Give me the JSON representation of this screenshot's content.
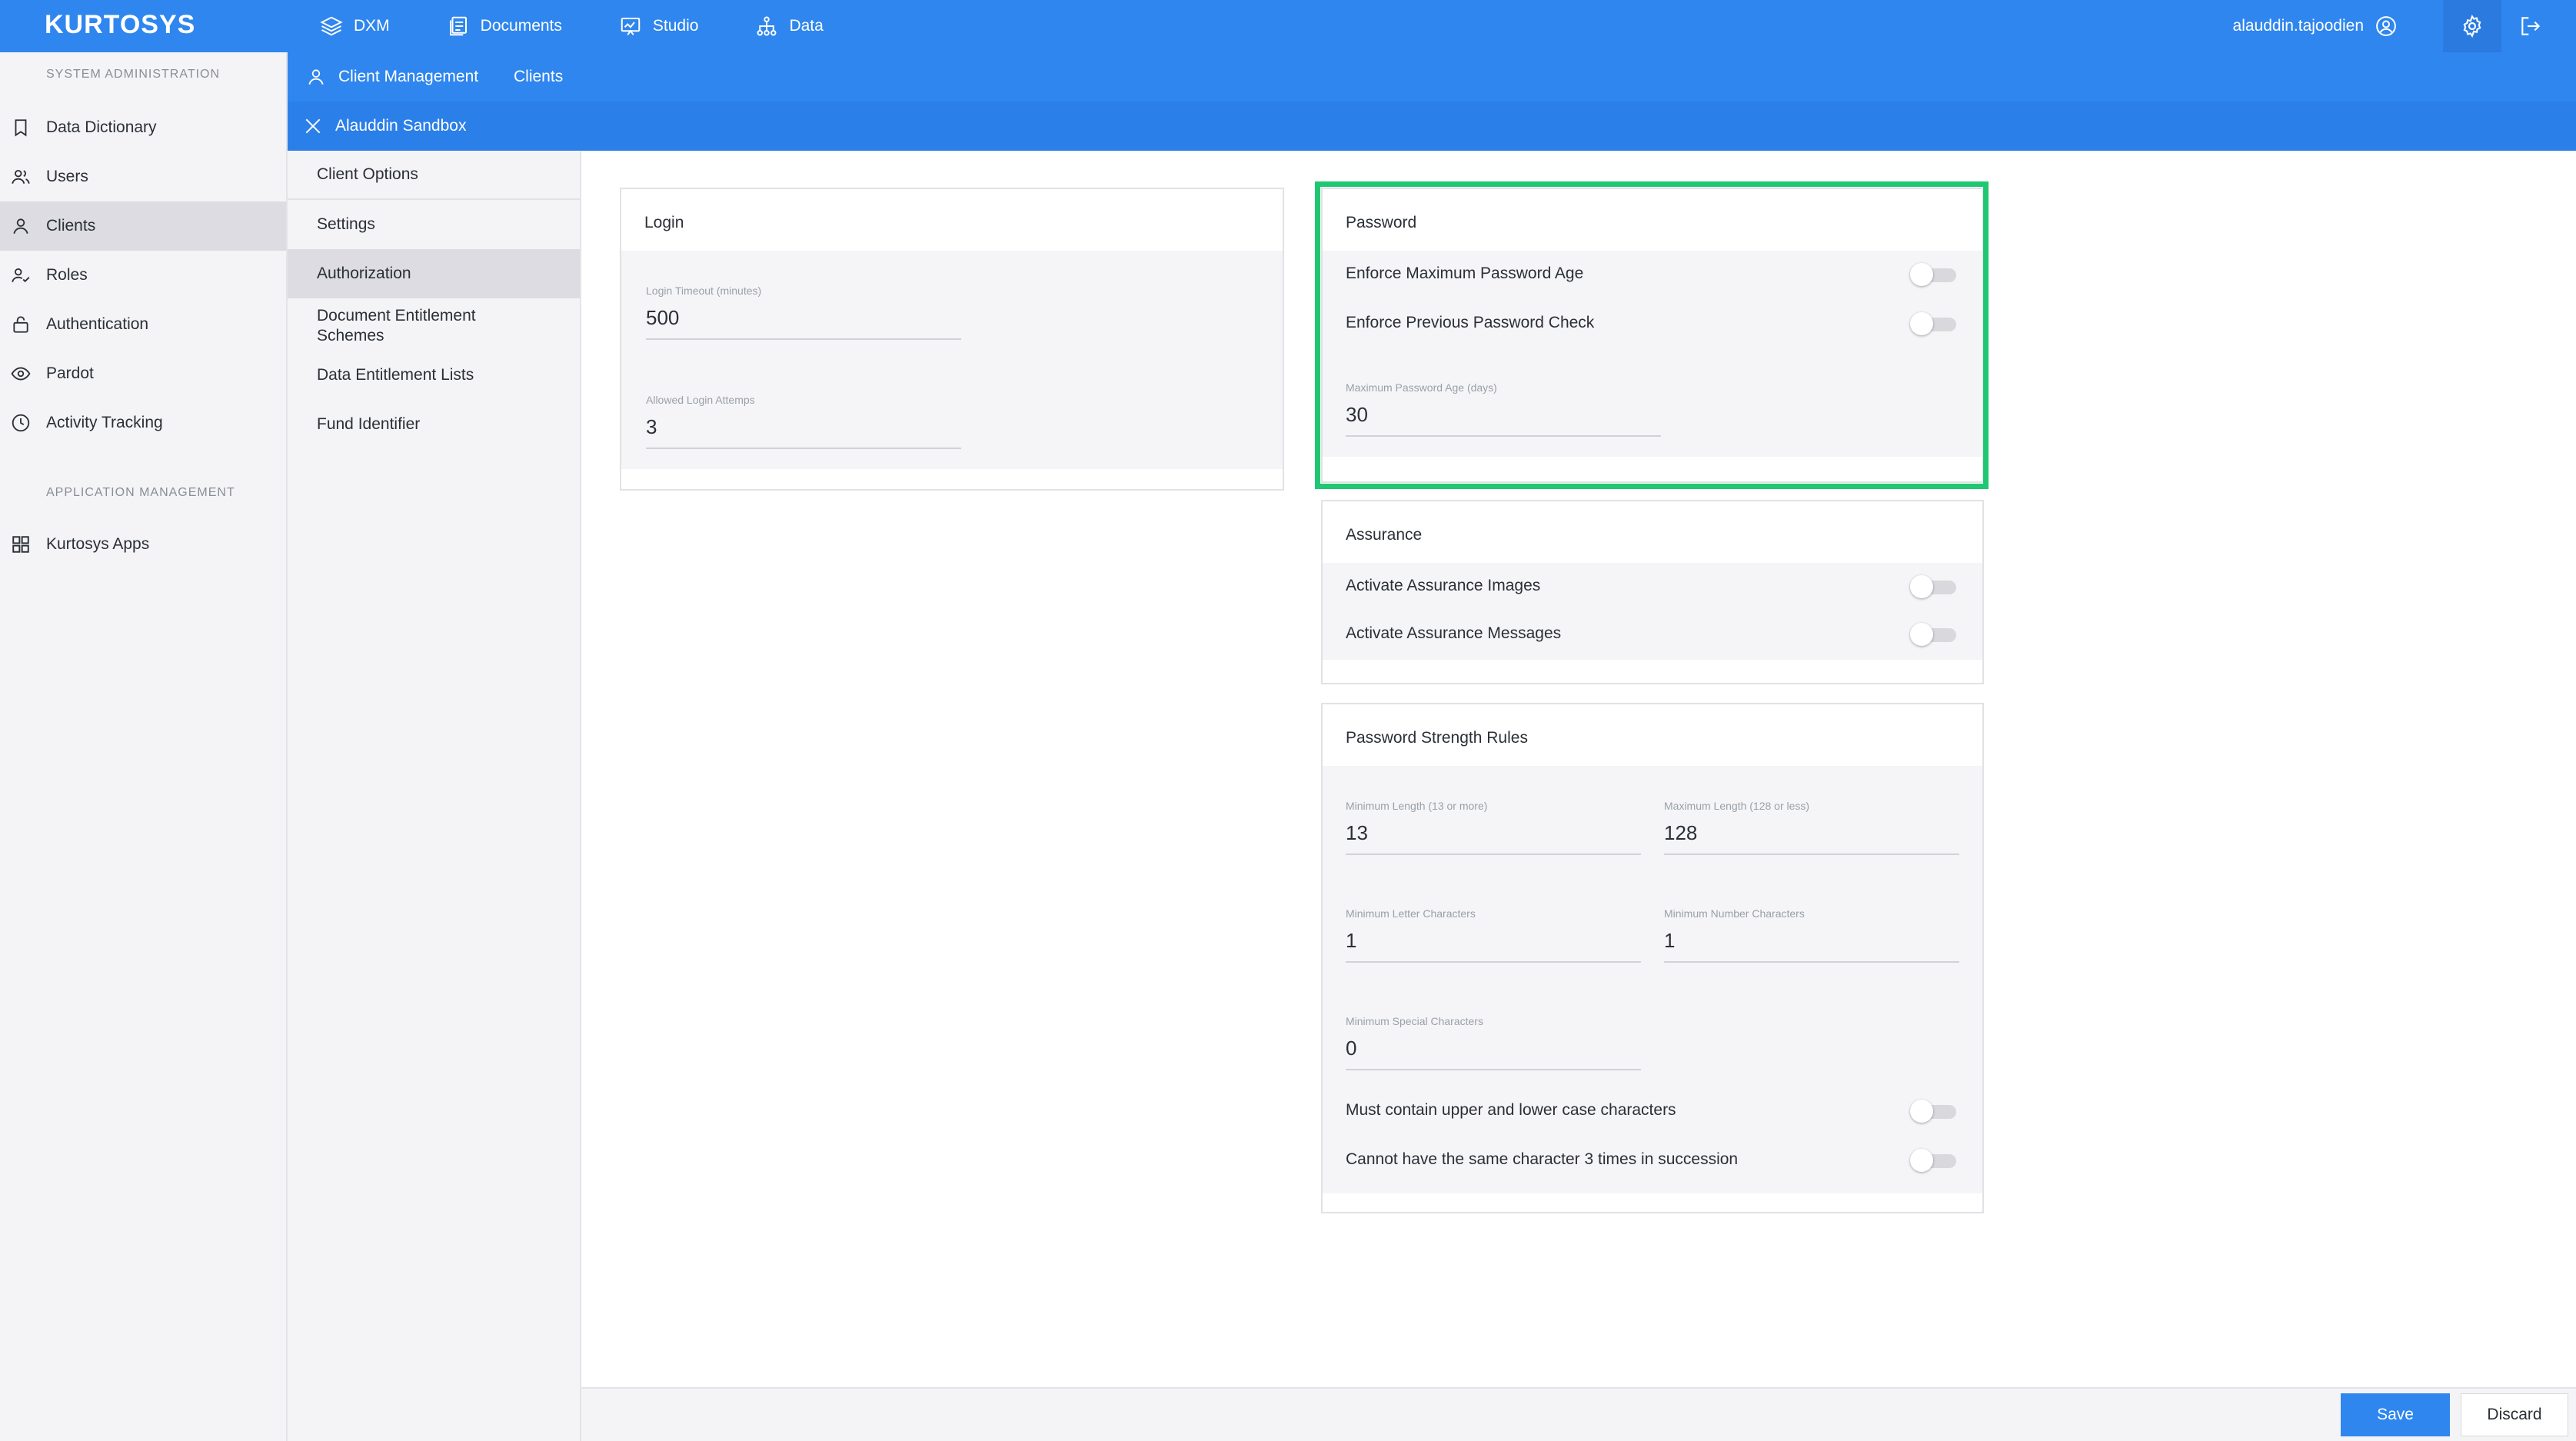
{
  "header": {
    "logo": "KURTOSYS",
    "nav": [
      {
        "label": "DXM",
        "icon": "layers-icon"
      },
      {
        "label": "Documents",
        "icon": "documents-icon"
      },
      {
        "label": "Studio",
        "icon": "studio-icon"
      },
      {
        "label": "Data",
        "icon": "data-icon"
      }
    ],
    "username": "alauddin.tajoodien",
    "user_icon": "user-circle-icon",
    "settings_icon": "gear-icon",
    "logout_icon": "logout-icon"
  },
  "sidebar": {
    "system_section": "SYSTEM ADMINISTRATION",
    "system_items": [
      {
        "label": "Data Dictionary",
        "icon": "bookmark-icon"
      },
      {
        "label": "Users",
        "icon": "users-icon"
      },
      {
        "label": "Clients",
        "icon": "client-icon",
        "active": true
      },
      {
        "label": "Roles",
        "icon": "roles-icon"
      },
      {
        "label": "Authentication",
        "icon": "lock-icon"
      },
      {
        "label": "Pardot",
        "icon": "eye-icon"
      },
      {
        "label": "Activity Tracking",
        "icon": "clock-icon"
      }
    ],
    "app_section": "APPLICATION MANAGEMENT",
    "app_items": [
      {
        "label": "Kurtosys Apps",
        "icon": "grid-icon"
      }
    ]
  },
  "breadcrumb": {
    "icon": "client-icon",
    "items": [
      "Client Management",
      "Clients"
    ]
  },
  "context": {
    "close_icon": "close-icon",
    "title": "Alauddin Sandbox"
  },
  "submenu": {
    "items": [
      {
        "label": "Client Options"
      },
      {
        "label": "Settings"
      },
      {
        "label": "Authorization",
        "active": true
      },
      {
        "label": "Document Entitlement Schemes"
      },
      {
        "label": "Data Entitlement Lists"
      },
      {
        "label": "Fund Identifier"
      }
    ]
  },
  "login": {
    "title": "Login",
    "timeout_label": "Login Timeout (minutes)",
    "timeout_value": "500",
    "attempts_label": "Allowed Login Attemps",
    "attempts_value": "3"
  },
  "password": {
    "title": "Password",
    "enforce_max_age_label": "Enforce Maximum Password Age",
    "enforce_max_age_on": false,
    "enforce_prev_check_label": "Enforce Previous Password Check",
    "enforce_prev_check_on": false,
    "max_age_label": "Maximum Password Age (days)",
    "max_age_value": "30"
  },
  "assurance": {
    "title": "Assurance",
    "images_label": "Activate Assurance Images",
    "images_on": false,
    "messages_label": "Activate Assurance Messages",
    "messages_on": false
  },
  "strength": {
    "title": "Password Strength Rules",
    "min_length_label": "Minimum Length (13 or more)",
    "min_length_value": "13",
    "max_length_label": "Maximum Length (128 or less)",
    "max_length_value": "128",
    "min_letters_label": "Minimum Letter Characters",
    "min_letters_value": "1",
    "min_numbers_label": "Minimum Number Characters",
    "min_numbers_value": "1",
    "min_special_label": "Minimum Special Characters",
    "min_special_value": "0",
    "upper_lower_label": "Must contain upper and lower case characters",
    "upper_lower_on": false,
    "no_repeat_label": "Cannot have the same character 3 times in succession",
    "no_repeat_on": false
  },
  "footer": {
    "save_label": "Save",
    "discard_label": "Discard"
  },
  "colors": {
    "primary": "#2f86ee",
    "highlight": "#20c773"
  }
}
